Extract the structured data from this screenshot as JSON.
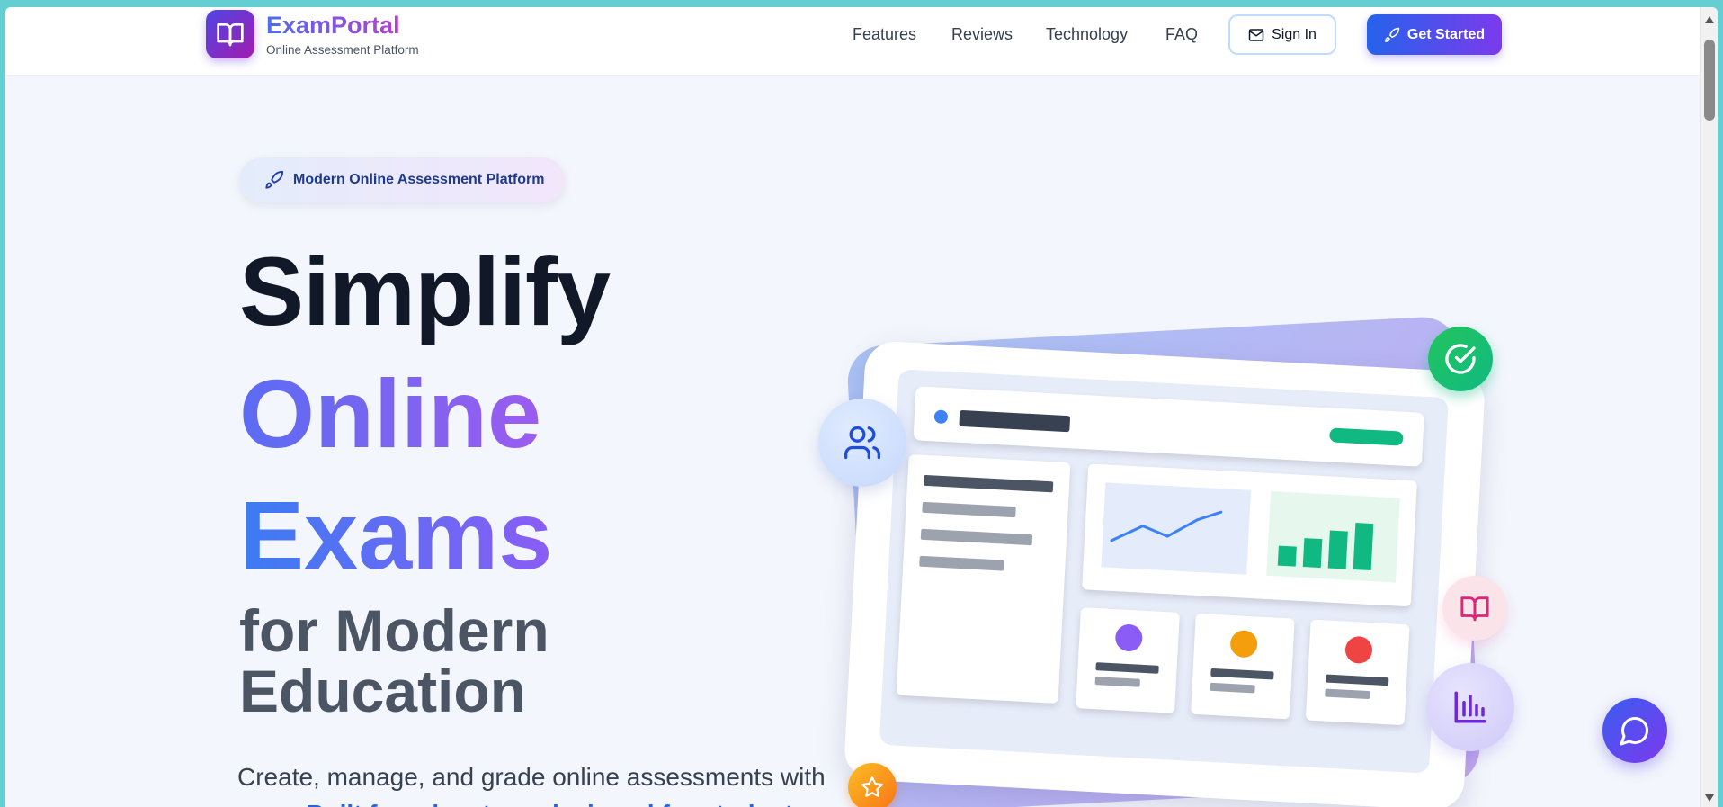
{
  "brand": {
    "name": "ExamPortal",
    "tagline": "Online Assessment Platform"
  },
  "nav": {
    "links": [
      "Features",
      "Reviews",
      "Technology",
      "FAQ"
    ],
    "sign_in": "Sign In",
    "get_started": "Get Started"
  },
  "hero": {
    "badge": "Modern Online Assessment Platform",
    "line1": "Simplify",
    "line2": "Online",
    "line3": "Exams",
    "line4": "for Modern Education",
    "lead": "Create, manage, and grade online assessments with ease.",
    "lead_highlight": "Built for educators, designed for students."
  },
  "icons": {
    "logo": "book-open-icon",
    "sign_in": "mail-icon",
    "get_started": "rocket-icon",
    "badge": "rocket-icon",
    "floating": [
      "users-icon",
      "check-circle-icon",
      "book-open-icon",
      "bar-chart-icon",
      "star-icon"
    ],
    "chat": "chat-bubble-icon"
  },
  "colors": {
    "primary": "#2563eb",
    "accent": "#7c3aed",
    "success": "#10b981",
    "window_border": "#64cfd3",
    "dashboard_dots": [
      "#8b5cf6",
      "#f59e0b",
      "#ef4444"
    ]
  }
}
